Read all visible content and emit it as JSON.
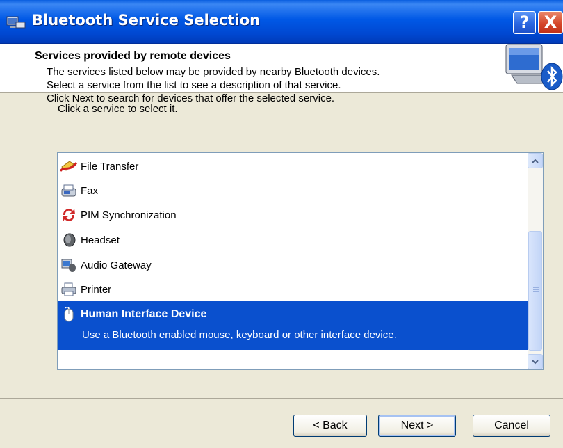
{
  "window": {
    "title": "Bluetooth Service Selection",
    "help_label": "?",
    "close_label": "X"
  },
  "header": {
    "title": "Services provided by remote devices",
    "lines": [
      "The services listed below may be provided by nearby Bluetooth devices.",
      "Select a service from the list to see a description of that service.",
      "Click Next to search for devices that offer the selected service."
    ]
  },
  "body": {
    "prompt": "Click a service to select it."
  },
  "services": [
    {
      "label": "File Transfer",
      "icon": "file-transfer-icon"
    },
    {
      "label": "Fax",
      "icon": "fax-icon"
    },
    {
      "label": "PIM Synchronization",
      "icon": "pim-sync-icon"
    },
    {
      "label": "Headset",
      "icon": "headset-icon"
    },
    {
      "label": "Audio Gateway",
      "icon": "audio-gateway-icon"
    },
    {
      "label": "Printer",
      "icon": "printer-icon"
    },
    {
      "label": "Human Interface Device",
      "icon": "mouse-icon",
      "selected": true,
      "description": "Use a Bluetooth enabled mouse, keyboard or other interface device."
    }
  ],
  "buttons": {
    "back": "< Back",
    "next": "Next >",
    "cancel": "Cancel"
  },
  "colors": {
    "titlebar": "#0058E6",
    "selection": "#0A50CE",
    "dialog": "#ECE9D8"
  }
}
